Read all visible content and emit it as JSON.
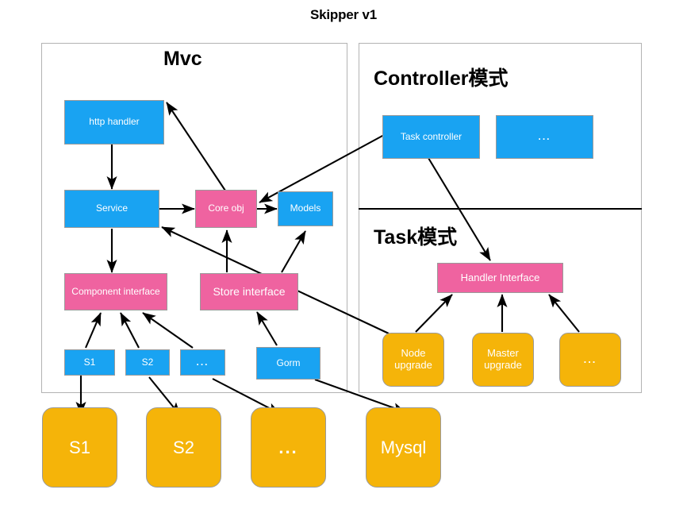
{
  "title": "Skipper v1",
  "panels": [
    {
      "id": "mvc",
      "title": "Mvc"
    },
    {
      "id": "controller",
      "title": "Controller模式"
    },
    {
      "id": "task",
      "title": "Task模式"
    }
  ],
  "mvc": {
    "nodes": [
      {
        "id": "http-handler",
        "label": "http handler",
        "color": "blue"
      },
      {
        "id": "service",
        "label": "Service",
        "color": "blue"
      },
      {
        "id": "core-obj",
        "label": "Core obj",
        "color": "pink"
      },
      {
        "id": "models",
        "label": "Models",
        "color": "blue"
      },
      {
        "id": "component-interface",
        "label": "Component interface",
        "color": "pink"
      },
      {
        "id": "store-interface",
        "label": "Store interface",
        "color": "pink"
      },
      {
        "id": "s1",
        "label": "S1",
        "color": "blue"
      },
      {
        "id": "s2",
        "label": "S2",
        "color": "blue"
      },
      {
        "id": "s-more",
        "label": "...",
        "color": "blue"
      },
      {
        "id": "gorm",
        "label": "Gorm",
        "color": "blue"
      }
    ]
  },
  "controller": {
    "nodes": [
      {
        "id": "task-controller",
        "label": "Task controller",
        "color": "blue"
      },
      {
        "id": "controller-more",
        "label": "...",
        "color": "blue"
      }
    ]
  },
  "task": {
    "nodes": [
      {
        "id": "handler-interface",
        "label": "Handler Interface",
        "color": "pink"
      },
      {
        "id": "node-upgrade",
        "label": "Node upgrade",
        "color": "orange"
      },
      {
        "id": "master-upgrade",
        "label": "Master upgrade",
        "color": "orange"
      },
      {
        "id": "task-more",
        "label": "...",
        "color": "orange"
      }
    ]
  },
  "backends": {
    "nodes": [
      {
        "id": "backend-s1",
        "label": "S1",
        "color": "orange"
      },
      {
        "id": "backend-s2",
        "label": "S2",
        "color": "orange"
      },
      {
        "id": "backend-more",
        "label": "...",
        "color": "orange"
      },
      {
        "id": "backend-mysql",
        "label": "Mysql",
        "color": "orange"
      }
    ]
  },
  "colors": {
    "blue": "#19A3F2",
    "pink": "#EF63A0",
    "orange": "#F5B409",
    "panel_border": "#b3b3b3",
    "arrow": "#000000",
    "text_on_node": "#ffffff"
  }
}
